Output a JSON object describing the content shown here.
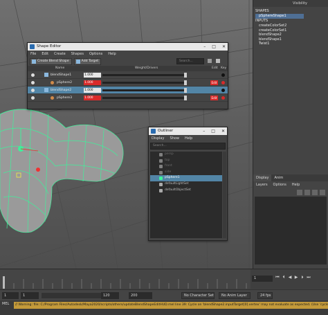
{
  "channel_box": {
    "visibility_label": "Visibility",
    "shapes_title": "SHAPES",
    "shape_selected": "pSphereShape1",
    "inputs_title": "INPUTS",
    "inputs": [
      "createColorSet2",
      "createColorSet1",
      "blendShape2",
      "blendShape1",
      "Twist1"
    ]
  },
  "layer_editor": {
    "tabs": [
      "Display",
      "Anim"
    ],
    "menus": [
      "Layers",
      "Options",
      "Help"
    ]
  },
  "shape_editor": {
    "title": "Shape Editor",
    "menu": [
      "File",
      "Edit",
      "Create",
      "Shapes",
      "Options",
      "Help"
    ],
    "create_blend_shape": "Create Blend Shape",
    "add_target": "Add Target",
    "search_placeholder": "Search...",
    "columns": {
      "name": "Name",
      "weight": "Weight/Drivers",
      "edit": "Edit",
      "key": "Key"
    },
    "rows": [
      {
        "name": "blendShape1",
        "value": "1.000",
        "knob": 1.0
      },
      {
        "name": "pSphere2",
        "value": "1.000",
        "knob": 1.0
      },
      {
        "name": "blendShape2",
        "value": "1.000",
        "knob": 1.0
      },
      {
        "name": "pSphere3",
        "value": "1.000",
        "knob": 1.0
      }
    ],
    "edit_label": "Edit"
  },
  "outliner": {
    "title": "Outliner",
    "menu": [
      "Display",
      "Show",
      "Help"
    ],
    "search_placeholder": "Search...",
    "items": [
      {
        "name": "persp",
        "dim": true
      },
      {
        "name": "top",
        "dim": true
      },
      {
        "name": "front",
        "dim": true
      },
      {
        "name": "side",
        "dim": true
      },
      {
        "name": "pSphere1",
        "dim": false
      },
      {
        "name": "defaultLightSet",
        "dim": false
      },
      {
        "name": "defaultObjectSet",
        "dim": false
      }
    ]
  },
  "timeline": {
    "current_frame": "1"
  },
  "range_slider": {
    "start": "1",
    "playback_start": "1",
    "range_end": "120",
    "end": "200",
    "character_set": "No Character Set",
    "anim_layer": "No Anim Layer",
    "fps": "24 fps"
  },
  "command_line": {
    "mel_label": "MEL",
    "warning": "// Warning: file: C:/Program Files/Autodesk/Maya2020/scripts/others/updateBlendShapeEditHUD.mel line 39: Cycle on 'blendShape2.inputTarget[0].vertex' may not evaluate as expected. (Use 'cycleCheck -e off' to disable this warning.)"
  }
}
